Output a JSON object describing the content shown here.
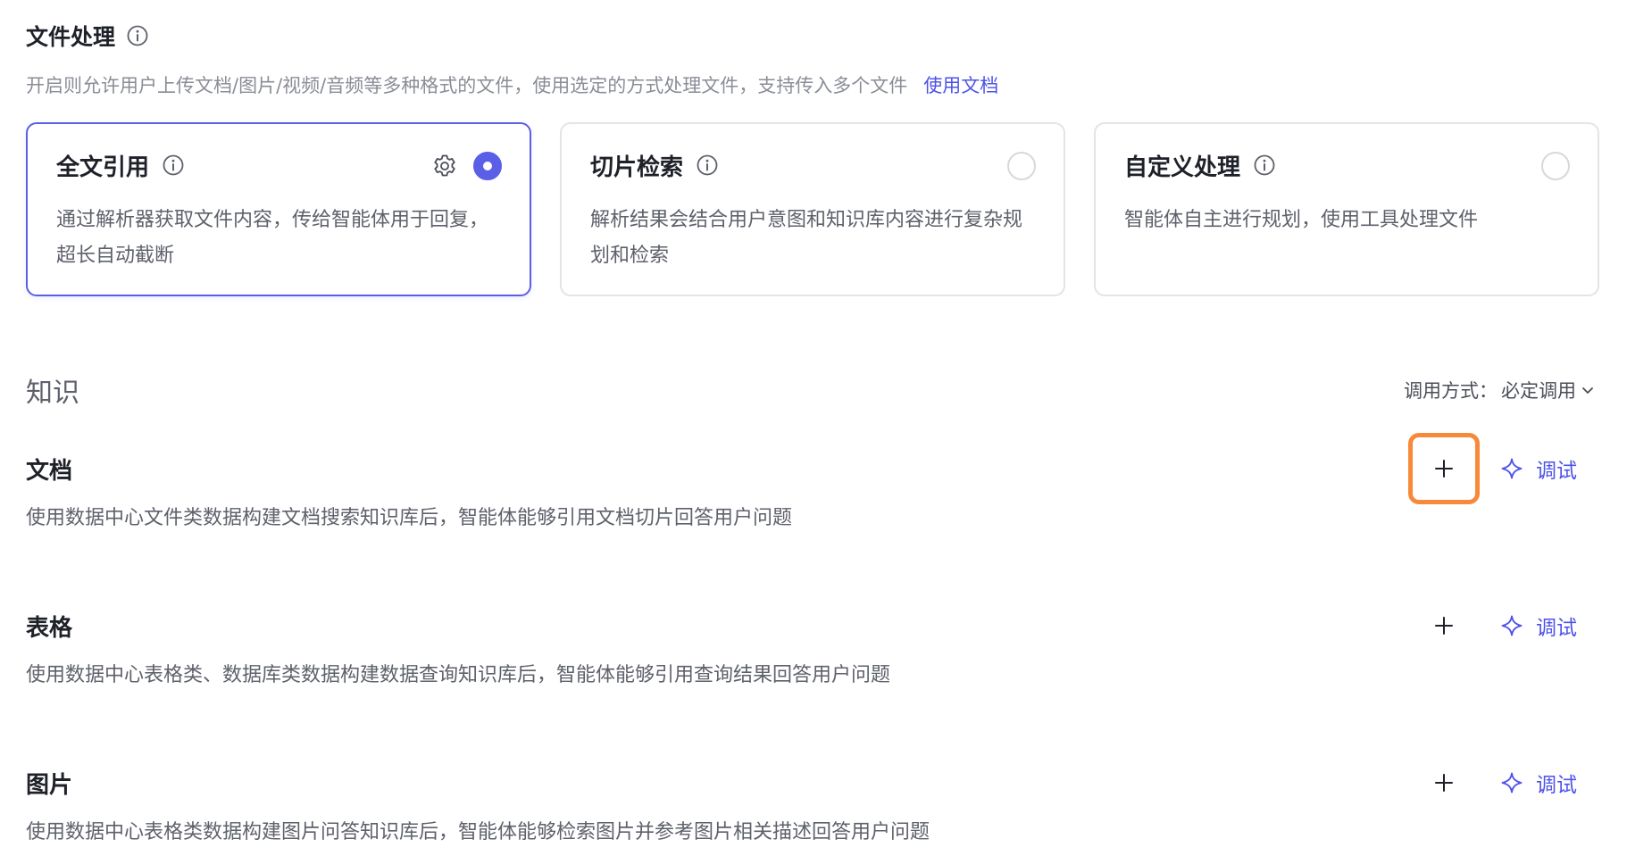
{
  "file_processing": {
    "title": "文件处理",
    "description": "开启则允许用户上传文档/图片/视频/音频等多种格式的文件，使用选定的方式处理文件，支持传入多个文件",
    "doc_link": "使用文档",
    "options": [
      {
        "title": "全文引用",
        "description": "通过解析器获取文件内容，传给智能体用于回复，超长自动截断",
        "selected": true,
        "has_settings": true
      },
      {
        "title": "切片检索",
        "description": "解析结果会结合用户意图和知识库内容进行复杂规划和检索",
        "selected": false,
        "has_settings": false
      },
      {
        "title": "自定义处理",
        "description": "智能体自主进行规划，使用工具处理文件",
        "selected": false,
        "has_settings": false
      }
    ]
  },
  "knowledge": {
    "title": "知识",
    "call_mode_label": "调用方式：",
    "call_mode_value": "必定调用",
    "items": [
      {
        "name": "文档",
        "description": "使用数据中心文件类数据构建文档搜索知识库后，智能体能够引用文档切片回答用户问题",
        "debug_label": "调试",
        "add_highlighted": true
      },
      {
        "name": "表格",
        "description": "使用数据中心表格类、数据库类数据构建数据查询知识库后，智能体能够引用查询结果回答用户问题",
        "debug_label": "调试",
        "add_highlighted": false
      },
      {
        "name": "图片",
        "description": "使用数据中心表格类数据构建图片问答知识库后，智能体能够检索图片并参考图片相关描述回答用户问题",
        "debug_label": "调试",
        "add_highlighted": false
      }
    ]
  },
  "colors": {
    "accent": "#5b5ee6",
    "link": "#4d53e8",
    "highlight": "#f7893b",
    "card_border": "#e3e4e8"
  },
  "icons": {
    "info": "info-icon",
    "settings": "gear-icon",
    "add": "plus-icon",
    "debug": "sparkle-icon",
    "dropdown": "chevron-down-icon"
  }
}
